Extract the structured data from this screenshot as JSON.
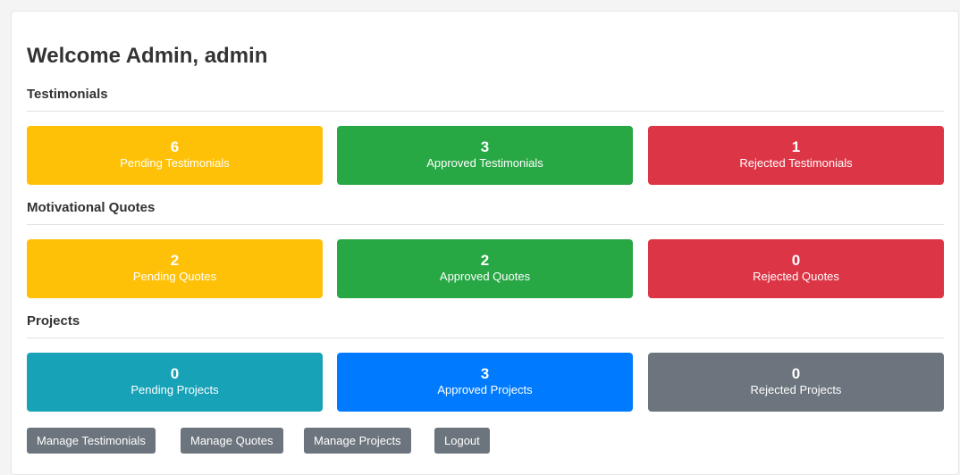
{
  "page": {
    "title": "Welcome Admin, admin"
  },
  "sections": [
    {
      "heading": "Testimonials",
      "cards": [
        {
          "count": "6",
          "label": "Pending Testimonials",
          "color": "#ffc107"
        },
        {
          "count": "3",
          "label": "Approved Testimonials",
          "color": "#28a745"
        },
        {
          "count": "1",
          "label": "Rejected Testimonials",
          "color": "#dc3545"
        }
      ]
    },
    {
      "heading": "Motivational Quotes",
      "cards": [
        {
          "count": "2",
          "label": "Pending Quotes",
          "color": "#ffc107"
        },
        {
          "count": "2",
          "label": "Approved Quotes",
          "color": "#28a745"
        },
        {
          "count": "0",
          "label": "Rejected Quotes",
          "color": "#dc3545"
        }
      ]
    },
    {
      "heading": "Projects",
      "cards": [
        {
          "count": "0",
          "label": "Pending Projects",
          "color": "#17a2b8"
        },
        {
          "count": "3",
          "label": "Approved Projects",
          "color": "#007bff"
        },
        {
          "count": "0",
          "label": "Rejected Projects",
          "color": "#6c757d"
        }
      ]
    }
  ],
  "actions": {
    "manage_testimonials": "Manage Testimonials",
    "manage_quotes": "Manage Quotes",
    "manage_projects": "Manage Projects",
    "logout": "Logout"
  }
}
